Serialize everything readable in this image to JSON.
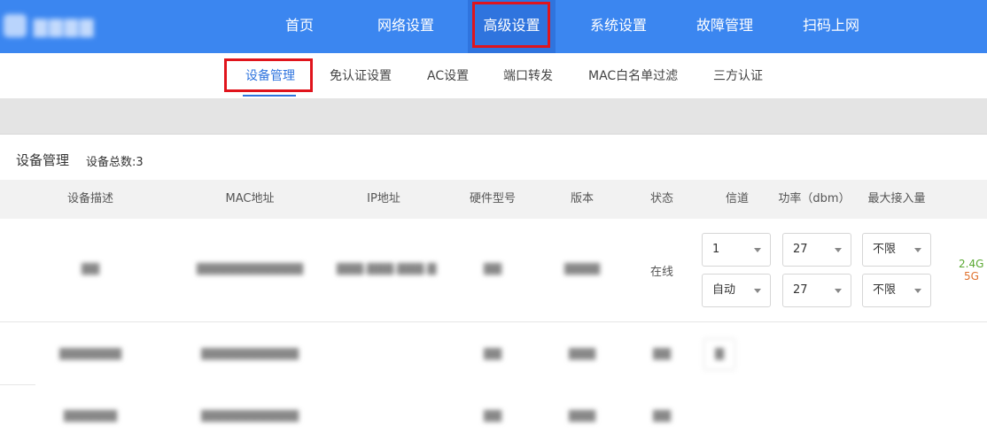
{
  "topnav": {
    "items": [
      {
        "label": "首页"
      },
      {
        "label": "网络设置"
      },
      {
        "label": "高级设置"
      },
      {
        "label": "系统设置"
      },
      {
        "label": "故障管理"
      },
      {
        "label": "扫码上网"
      }
    ],
    "active_index": 2
  },
  "subnav": {
    "items": [
      {
        "label": "设备管理"
      },
      {
        "label": "免认证设置"
      },
      {
        "label": "AC设置"
      },
      {
        "label": "端口转发"
      },
      {
        "label": "MAC白名单过滤"
      },
      {
        "label": "三方认证"
      }
    ],
    "active_index": 0
  },
  "section": {
    "title": "设备管理",
    "count_label": "设备总数:3"
  },
  "table": {
    "headers": [
      "设备描述",
      "MAC地址",
      "IP地址",
      "硬件型号",
      "版本",
      "状态",
      "信道",
      "功率（dbm）",
      "最大接入量"
    ],
    "rows": [
      {
        "status": "在线",
        "channel_24g": "1",
        "channel_5g": "自动",
        "power_24g": "27",
        "power_5g": "27",
        "max_24g": "不限",
        "max_5g": "不限",
        "band_24g": "2.4G",
        "band_5g": "5G"
      }
    ]
  },
  "colors": {
    "nav_bg": "#3b86f0",
    "accent": "#2f74de",
    "highlight_box": "#e0141c",
    "band_24g": "#5aa832",
    "band_5g": "#e0722e"
  }
}
